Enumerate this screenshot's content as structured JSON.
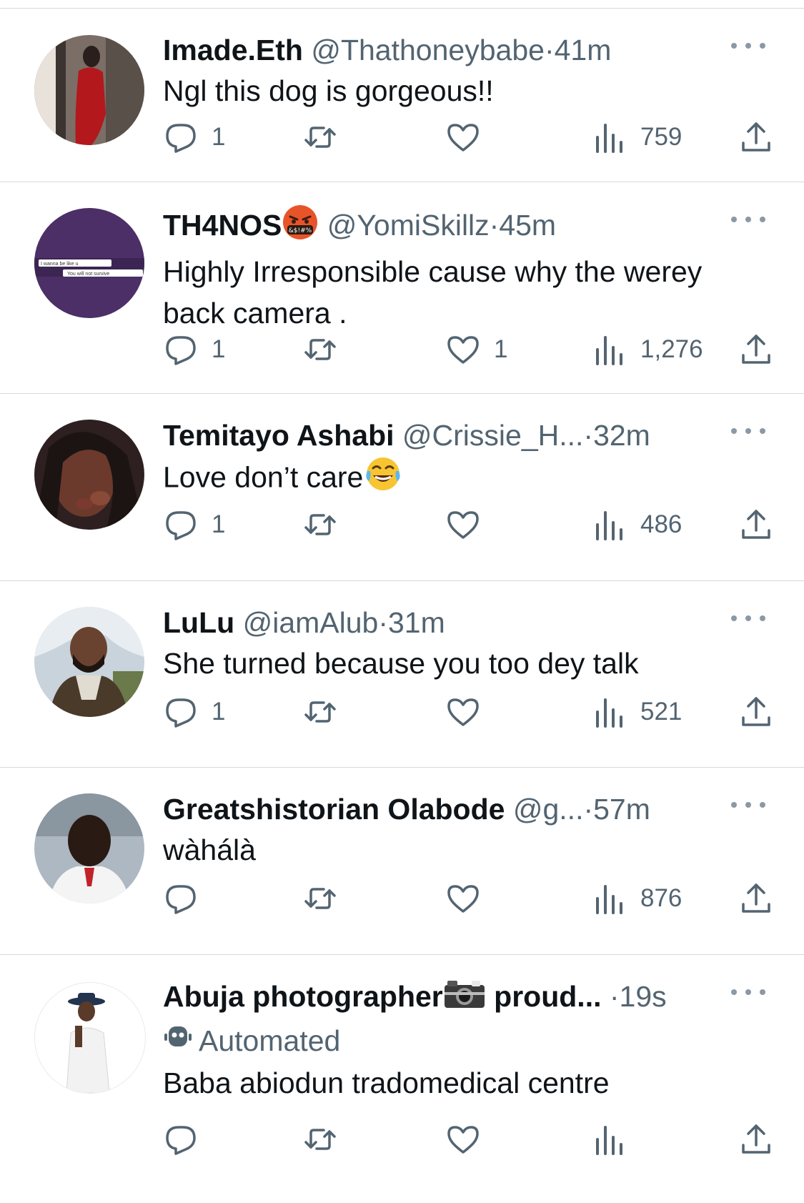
{
  "replies": [
    {
      "name": "Imade.Eth",
      "handle": "@Thathoneybabe",
      "dot": "·",
      "time": "41m",
      "text": "Ngl this dog is gorgeous!!",
      "reply_count": "1",
      "retweet_count": "",
      "like_count": "",
      "views": "759"
    },
    {
      "name": "TH4NOS",
      "name_emoji": "face-with-symbols-on-mouth",
      "handle": "@YomiSkillz",
      "dot": "·",
      "time": "45m",
      "text": "Highly Irresponsible cause why the werey back camera .",
      "reply_count": "1",
      "retweet_count": "",
      "like_count": "1",
      "views": "1,276",
      "avatar_text_1": "I wanna be like u",
      "avatar_text_2": "You will not survive"
    },
    {
      "name": "Temitayo Ashabi",
      "handle": "@Crissie_H...",
      "dot": "·",
      "time": "32m",
      "text": "Love don’t care",
      "text_emoji": "face-with-tears-of-joy",
      "reply_count": "1",
      "retweet_count": "",
      "like_count": "",
      "views": "486"
    },
    {
      "name": "LuLu",
      "handle": "@iamAlub",
      "dot": "·",
      "time": "31m",
      "text": "She turned because you too dey talk",
      "reply_count": "1",
      "retweet_count": "",
      "like_count": "",
      "views": "521"
    },
    {
      "name": "Greatshistorian Olabode",
      "handle": "@g...",
      "dot": "·",
      "time": "57m",
      "text": "wàhálà",
      "reply_count": "",
      "retweet_count": "",
      "like_count": "",
      "views": "876"
    },
    {
      "name": "Abuja photographer",
      "name_emoji": "camera-with-flash",
      "name_suffix": "proud...",
      "dot": "·",
      "time": "19s",
      "automated_label": "Automated",
      "text": "Baba abiodun tradomedical centre",
      "reply_count": "",
      "retweet_count": "",
      "like_count": "",
      "views": ""
    }
  ],
  "colors": {
    "text": "#0f1419",
    "secondary": "#536471",
    "divider": "#d4d9dc"
  },
  "icons": [
    "reply-icon",
    "retweet-icon",
    "like-icon",
    "views-icon",
    "share-icon",
    "more-icon",
    "robot-icon"
  ]
}
